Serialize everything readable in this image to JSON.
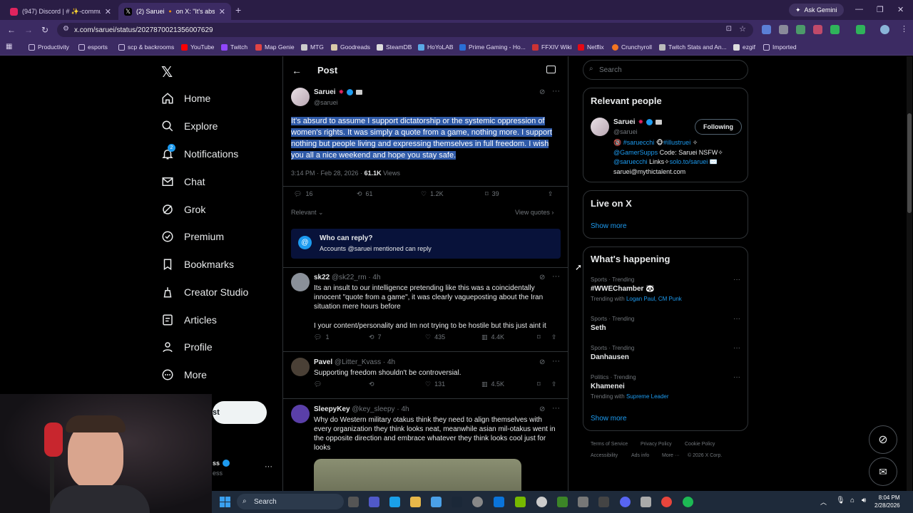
{
  "browser": {
    "tabs": [
      {
        "title": "(947) Discord | # ✨-communit...",
        "active": false
      },
      {
        "title": "(2) Saruei 🔸 on X: \"It's absurd",
        "active": true
      }
    ],
    "ask_gemini": "Ask Gemini",
    "url": "x.com/saruei/status/2027870021356007629",
    "bookmarks": [
      "Productivity",
      "esports",
      "scp & backrooms",
      "YouTube",
      "Twitch",
      "Map Genie",
      "MTG",
      "Goodreads",
      "SteamDB",
      "HoYoLAB",
      "Prime Gaming - Ho...",
      "FFXIV Wiki",
      "Netflix",
      "Crunchyroll",
      "Twitch Stats and An...",
      "ezgif",
      "Imported"
    ]
  },
  "sidebar": {
    "items": [
      {
        "label": "Home",
        "icon": "home-icon"
      },
      {
        "label": "Explore",
        "icon": "search-icon"
      },
      {
        "label": "Notifications",
        "icon": "bell-icon",
        "badge": "2"
      },
      {
        "label": "Chat",
        "icon": "mail-icon"
      },
      {
        "label": "Grok",
        "icon": "grok-icon"
      },
      {
        "label": "Premium",
        "icon": "verified-icon"
      },
      {
        "label": "Bookmarks",
        "icon": "bookmark-icon"
      },
      {
        "label": "Creator Studio",
        "icon": "creator-icon"
      },
      {
        "label": "Articles",
        "icon": "article-icon"
      },
      {
        "label": "Profile",
        "icon": "person-icon"
      },
      {
        "label": "More",
        "icon": "more-circle-icon"
      }
    ],
    "post_button": "st",
    "account_name_frag": "ss",
    "account_handle_frag": "ess"
  },
  "main": {
    "header": "Post",
    "tweet": {
      "name": "Saruei",
      "handle": "@saruei",
      "text": "It's absurd to assume I support dictatorship or the systemic oppression of women's rights. It was simply a quote from a game, nothing more. I support nothing but people living and expressing themselves in full freedom.  I wish you all a nice weekend and hope you stay safe.",
      "timestamp": "3:14 PM · Feb 28, 2026 · ",
      "views_count": "61.1K",
      "views_label": " Views",
      "stats": {
        "replies": "16",
        "reposts": "61",
        "likes": "1.2K",
        "bookmarks": "39"
      }
    },
    "sort_label": "Relevant",
    "view_quotes": "View quotes",
    "who_can_reply": {
      "title": "Who can reply?",
      "desc": "Accounts @saruei mentioned can reply"
    },
    "replies": [
      {
        "name": "sk22",
        "handle": "@sk22_rm",
        "time": "· 4h",
        "text": "Its an insult to our intelligence pretending like this was a coincidentally innocent \"quote from a game\", it was clearly vagueposting about the Iran situation mere hours before",
        "text2": "I your content/personality and Im not trying to be hostile but this just aint it",
        "stats": {
          "replies": "1",
          "reposts": "7",
          "likes": "435",
          "views": "4.4K"
        }
      },
      {
        "name": "Pavel",
        "handle": "@Litter_Kvass",
        "time": "· 4h",
        "text": "Supporting freedom shouldn't be controversial.",
        "stats": {
          "replies": "",
          "reposts": "",
          "likes": "131",
          "views": "4.5K"
        }
      },
      {
        "name": "SleepyKey",
        "handle": "@key_sleepy",
        "time": "· 4h",
        "text": "Why do Western military otakus think they need to align themselves with every organization they think looks neat, meanwhile asian mil-otakus went in the opposite direction and embrace whatever they think looks cool just for looks"
      }
    ]
  },
  "right": {
    "search_placeholder": "Search",
    "relevant_people": {
      "title": "Relevant people",
      "name": "Saruei",
      "handle": "@saruei",
      "follow_label": "Following",
      "bio_line1_prefix": "🔞 ",
      "bio_tag1": "#saruecchi",
      "bio_tag2": "#illustruei",
      "bio_line1_suffix": " ✧",
      "bio_line2_link": "@GamerSupps",
      "bio_line2_text": " Code: Saruei NSFW✧",
      "bio_line3_link": "@saruecchi",
      "bio_line3_text": " Links✧",
      "bio_line3_link2": "solo.to/saruei",
      "bio_line3_suffix": " ✉️",
      "bio_line4": "saruei@mythictalent.com"
    },
    "live": {
      "title": "Live on X",
      "show_more": "Show more"
    },
    "happening": {
      "title": "What's happening",
      "trends": [
        {
          "category": "Sports · Trending",
          "name": "#WWEChamber 🐼",
          "with_prefix": "Trending with ",
          "with": "Logan Paul, CM Punk"
        },
        {
          "category": "Sports · Trending",
          "name": "Seth",
          "with_prefix": "",
          "with": ""
        },
        {
          "category": "Sports · Trending",
          "name": "Danhausen",
          "with_prefix": "",
          "with": ""
        },
        {
          "category": "Politics · Trending",
          "name": "Khamenei",
          "with_prefix": "Trending with ",
          "with": "Supreme Leader"
        }
      ],
      "show_more": "Show more"
    },
    "footer": {
      "terms": "Terms of Service",
      "privacy": "Privacy Policy",
      "cookie": "Cookie Policy",
      "accessibility": "Accessibility",
      "ads": "Ads info",
      "more": "More ···",
      "copyright": "© 2026 X Corp."
    }
  },
  "taskbar": {
    "search_placeholder": "Search",
    "time": "8:04 PM",
    "date": "2/28/2026"
  },
  "colors": {
    "accent": "#1d9bf0",
    "background": "#000000",
    "browser_frame": "#3c2b63",
    "selection": "#2f5aa8"
  }
}
